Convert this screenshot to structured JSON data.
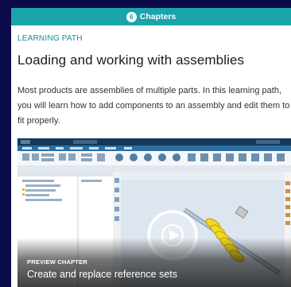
{
  "header": {
    "chapter_count": "6",
    "chapters_label": "Chapters"
  },
  "path": {
    "label": "LEARNING PATH",
    "title": "Loading and working with assemblies",
    "description": "Most products are assemblies of multiple parts. In this learning path, you will learn how to add components to an assembly and edit them to fit properly."
  },
  "preview": {
    "label": "PREVIEW CHAPTER",
    "chapter_title": "Create and replace reference sets"
  },
  "colors": {
    "accent_teal": "#1aa3a9",
    "page_background": "#0b0b4a",
    "spring_yellow": "#f2d81f"
  }
}
